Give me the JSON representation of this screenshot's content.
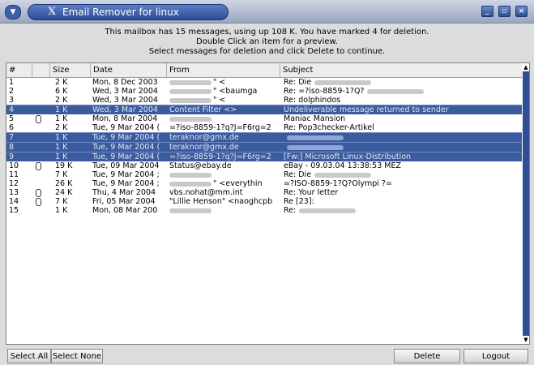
{
  "window": {
    "title": "Email Remover for linux",
    "logo": "X",
    "menu_glyph": "▼",
    "minimize": "_",
    "maximize": "▫",
    "close": "×"
  },
  "info": {
    "line1": "This mailbox has 15 messages, using up 108 K. You have marked 4 for deletion.",
    "line2": "Double Click an item for a preview.",
    "line3": "Select messages for deletion and click Delete to continue."
  },
  "table": {
    "headers": {
      "num": "#",
      "attach": "",
      "size": "Size",
      "date": "Date",
      "from": "From",
      "subject": "Subject"
    },
    "rows": [
      {
        "num": "1",
        "attach": false,
        "size": "2 K",
        "date": "Mon, 8 Dec 2003",
        "from": "\" <",
        "from_blur": true,
        "subject": "Re: Die",
        "subject_blur": true,
        "selected": false
      },
      {
        "num": "2",
        "attach": false,
        "size": "6 K",
        "date": "Wed, 3 Mar 2004",
        "from": "\" <baumga",
        "from_blur": true,
        "subject": "Re: =?iso-8859-1?Q?",
        "subject_blur": true,
        "selected": false
      },
      {
        "num": "3",
        "attach": false,
        "size": "2 K",
        "date": "Wed, 3 Mar 2004",
        "from": "\" <",
        "from_blur": true,
        "subject": "Re: dolphindos",
        "subject_blur": false,
        "selected": false
      },
      {
        "num": "4",
        "attach": false,
        "size": "1 K",
        "date": "Wed, 3 Mar 2004",
        "from": "Content Filter <>",
        "from_blur": false,
        "subject": "Undeliverable message returned to sender",
        "subject_blur": false,
        "selected": true
      },
      {
        "num": "5",
        "attach": true,
        "size": "1 K",
        "date": "Mon, 8 Mar 2004",
        "from": "",
        "from_blur": true,
        "subject": "Maniac Mansion",
        "subject_blur": false,
        "selected": false
      },
      {
        "num": "6",
        "attach": false,
        "size": "2 K",
        "date": "Tue, 9 Mar 2004 (",
        "from": "=?iso-8859-1?q?J=F6rg=2",
        "from_blur": false,
        "subject": "Re: Pop3checker-Artikel",
        "subject_blur": false,
        "selected": false
      },
      {
        "num": "7",
        "attach": false,
        "size": "1 K",
        "date": "Tue, 9 Mar 2004 (",
        "from": "teraknor@gmx.de",
        "from_blur": false,
        "subject": "",
        "subject_blur": true,
        "selected": true
      },
      {
        "num": "8",
        "attach": false,
        "size": "1 K",
        "date": "Tue, 9 Mar 2004 (",
        "from": "teraknor@gmx.de",
        "from_blur": false,
        "subject": "",
        "subject_blur": true,
        "selected": true
      },
      {
        "num": "9",
        "attach": false,
        "size": "1 K",
        "date": "Tue, 9 Mar 2004 (",
        "from": "=?iso-8859-1?q?J=F6rg=2",
        "from_blur": false,
        "subject": "[Fw:] Microsoft  Linux-Distribution",
        "subject_blur": false,
        "selected": true
      },
      {
        "num": "10",
        "attach": true,
        "size": "19 K",
        "date": "Tue, 09 Mar 2004",
        "from": "Status@ebay.de",
        "from_blur": false,
        "subject": "eBay -  09.03.04 13:38:53 MEZ",
        "subject_blur": false,
        "selected": false
      },
      {
        "num": "11",
        "attach": false,
        "size": "7 K",
        "date": "Tue, 9 Mar 2004 ;",
        "from": "",
        "from_blur": true,
        "subject": "Re: Die",
        "subject_blur": true,
        "selected": false
      },
      {
        "num": "12",
        "attach": false,
        "size": "26 K",
        "date": "Tue, 9 Mar 2004 ;",
        "from": "\" <everythin",
        "from_blur": true,
        "subject": "=?ISO-8859-1?Q?Olympi ?=",
        "subject_blur": false,
        "selected": false
      },
      {
        "num": "13",
        "attach": true,
        "size": "24 K",
        "date": "Thu, 4 Mar 2004",
        "from": "vbs.nohat@mm.int",
        "from_blur": false,
        "subject": "Re: Your letter",
        "subject_blur": false,
        "selected": false
      },
      {
        "num": "14",
        "attach": true,
        "size": "7 K",
        "date": "Fri, 05 Mar 2004",
        "from": "\"Lillie Henson\" <naoghcpb",
        "from_blur": false,
        "subject": "Re [23]:",
        "subject_blur": false,
        "selected": false
      },
      {
        "num": "15",
        "attach": false,
        "size": "1 K",
        "date": "Mon, 08 Mar 200",
        "from": "",
        "from_blur": true,
        "subject": "Re:",
        "subject_blur": true,
        "selected": false
      }
    ]
  },
  "buttons": {
    "select_all": "Select All",
    "select_none": "Select None",
    "delete": "Delete",
    "logout": "Logout"
  },
  "scrollbar": {
    "up": "▲",
    "down": "▼"
  }
}
